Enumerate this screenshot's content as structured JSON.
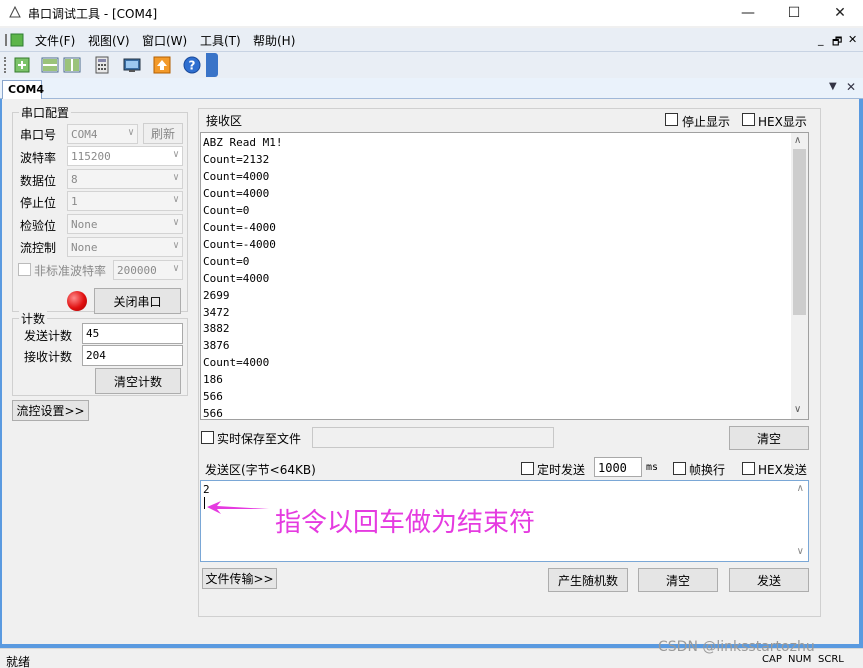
{
  "window": {
    "title": "串口调试工具 - [COM4]",
    "minimize_glyph": "—",
    "maximize_glyph": "☐",
    "close_glyph": "✕"
  },
  "menubar": {
    "items": [
      "文件(F)",
      "视图(V)",
      "窗口(W)",
      "工具(T)",
      "帮助(H)"
    ],
    "mdi_controls": [
      "_",
      "🗗",
      "✕"
    ]
  },
  "toolbar": {
    "icons": [
      "new-icon",
      "split-horizontal-icon",
      "split-vertical-icon",
      "calculator-icon",
      "monitor-icon",
      "upload-icon",
      "help-icon"
    ]
  },
  "tab": {
    "label": "COM4"
  },
  "serial_config": {
    "group_title": "串口配置",
    "port_label": "串口号",
    "port_value": "COM4",
    "refresh_button": "刷新",
    "baud_label": "波特率",
    "baud_value": "115200",
    "databits_label": "数据位",
    "databits_value": "8",
    "stopbits_label": "停止位",
    "stopbits_value": "1",
    "parity_label": "检验位",
    "parity_value": "None",
    "flow_label": "流控制",
    "flow_value": "None",
    "nonstd_label": "非标准波特率",
    "nonstd_value": "200000",
    "close_port_button": "关闭串口",
    "status_led_color": "#e01010"
  },
  "counter": {
    "group_title": "计数",
    "send_label": "发送计数",
    "send_value": "45",
    "recv_label": "接收计数",
    "recv_value": "204",
    "clear_button": "清空计数"
  },
  "flow_settings_button": "流控设置>>",
  "receive": {
    "title": "接收区",
    "stop_display_label": "停止显示",
    "hex_display_label": "HEX显示",
    "lines": [
      "ABZ Read M1!",
      "Count=2132",
      "Count=4000",
      "Count=4000",
      "Count=0",
      "Count=-4000",
      "Count=-4000",
      "Count=0",
      "Count=4000",
      "2699",
      "3472",
      "3882",
      "3876",
      "Count=4000",
      "186",
      "566",
      "566"
    ],
    "save_file_label": "实时保存至文件",
    "clear_button": "清空"
  },
  "send": {
    "title": "发送区(字节<64KB)",
    "timed_send_label": "定时发送",
    "interval_value": "1000",
    "interval_unit": "ms",
    "newline_label": "帧换行",
    "hex_send_label": "HEX发送",
    "content": "2",
    "annotation": "指令以回车做为结束符",
    "annotation_color": "#e53be0",
    "file_transfer_button": "文件传输>>",
    "random_button": "产生随机数",
    "clear_button": "清空",
    "send_button": "发送"
  },
  "statusbar": {
    "text": "就绪",
    "indicators": [
      "CAP",
      "NUM",
      "SCRL"
    ],
    "watermark": "CSDN @linksstartozhu"
  }
}
